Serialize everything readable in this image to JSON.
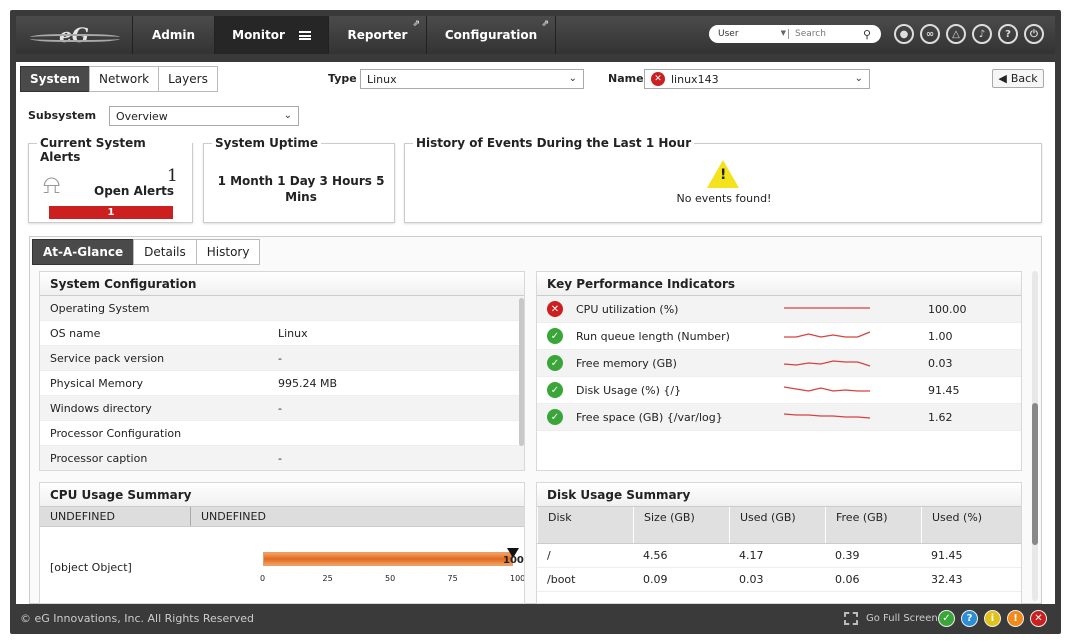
{
  "nav": {
    "logo": "eG",
    "items": [
      {
        "label": "Admin"
      },
      {
        "label": "Monitor"
      },
      {
        "label": "Reporter"
      },
      {
        "label": "Configuration"
      }
    ],
    "user_select": "User",
    "search_placeholder": "Search"
  },
  "toolbar": {
    "tabs": [
      "System",
      "Network",
      "Layers"
    ],
    "type_label": "Type",
    "type_value": "Linux",
    "name_label": "Name",
    "name_value": "linux143",
    "back_label": "Back"
  },
  "subsystem": {
    "label": "Subsystem",
    "value": "Overview"
  },
  "alerts": {
    "title": "Current System Alerts",
    "count": "1",
    "label": "Open Alerts",
    "bar_value": "1"
  },
  "uptime": {
    "title": "System Uptime",
    "value": "1 Month 1 Day 3 Hours 5 Mins"
  },
  "events": {
    "title": "History of Events During the Last 1 Hour",
    "message": "No events found!"
  },
  "section_tabs": [
    "At-A-Glance",
    "Details",
    "History"
  ],
  "sysconfig": {
    "title": "System Configuration",
    "rows": [
      {
        "k": "Operating System",
        "v": ""
      },
      {
        "k": "OS name",
        "v": "Linux"
      },
      {
        "k": "Service pack version",
        "v": "-"
      },
      {
        "k": "Physical Memory",
        "v": "995.24 MB"
      },
      {
        "k": "Windows directory",
        "v": "-"
      },
      {
        "k": "Processor Configuration",
        "v": ""
      },
      {
        "k": "Processor caption",
        "v": "-"
      }
    ]
  },
  "kpi": {
    "title": "Key Performance Indicators",
    "rows": [
      {
        "status": "error",
        "name": "CPU utilization (%)",
        "value": "100.00",
        "trend": [
          5,
          5,
          5,
          5,
          5,
          5,
          5,
          5
        ]
      },
      {
        "status": "ok",
        "name": "Run queue length (Number)",
        "value": "1.00",
        "trend": [
          7,
          7,
          4,
          7,
          5,
          7,
          7,
          2
        ]
      },
      {
        "status": "ok",
        "name": "Free memory (GB)",
        "value": "0.03",
        "trend": [
          7,
          8,
          6,
          7,
          4,
          5,
          5,
          9
        ]
      },
      {
        "status": "ok",
        "name": "Disk Usage (%) {/}",
        "value": "91.45",
        "trend": [
          3,
          5,
          7,
          4,
          7,
          6,
          7,
          7
        ]
      },
      {
        "status": "ok",
        "name": "Free space (GB) {/var/log}",
        "value": "1.62",
        "trend": [
          3,
          4,
          4,
          5,
          5,
          6,
          6,
          7
        ]
      }
    ]
  },
  "cpu": {
    "title": "CPU Usage Summary",
    "headers": [
      "UNDEFINED",
      "UNDEFINED"
    ],
    "row_label": "[object Object]",
    "gauge_value": 100,
    "gauge_label": "100",
    "ticks": [
      "0",
      "25",
      "50",
      "75",
      "100"
    ]
  },
  "disk": {
    "title": "Disk Usage Summary",
    "headers": [
      "Disk",
      "Size (GB)",
      "Used (GB)",
      "Free (GB)",
      "Used (%)"
    ],
    "rows": [
      [
        "/",
        "4.56",
        "4.17",
        "0.39",
        "91.45"
      ],
      [
        "/boot",
        "0.09",
        "0.03",
        "0.06",
        "32.43"
      ]
    ]
  },
  "footer": {
    "copyright": "© eG Innovations, Inc. All Rights Reserved",
    "fullscreen": "Go Full Screen"
  },
  "colors": {
    "accent_red": "#cc1f1f",
    "ok_green": "#3aa63a",
    "gauge_orange": "#f08030"
  }
}
